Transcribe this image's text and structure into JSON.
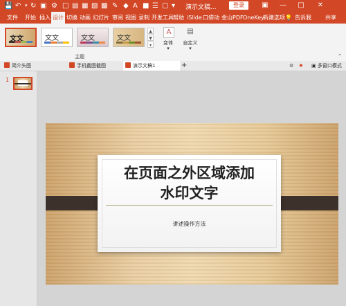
{
  "titlebar": {
    "doc_title": "演示文稿...",
    "login": "登录",
    "qa_icons": [
      "save-icon",
      "undo-icon",
      "redo-icon",
      "start-icon"
    ]
  },
  "menu": {
    "items": [
      "文件",
      "开始",
      "插入",
      "设计",
      "切换",
      "动画",
      "幻灯片",
      "审阅",
      "视图",
      "录制",
      "开发工具",
      "帮助",
      "iSlide",
      "口袋动",
      "金山PDF",
      "OneKey",
      "新建选项",
      "告诉我",
      "共享"
    ],
    "active_index": 3
  },
  "ribbon": {
    "theme_labels": [
      "文文",
      "文文",
      "文文",
      "文文"
    ],
    "themes_group_label": "主题",
    "variants_label": "变体",
    "customize_label": "自定义"
  },
  "tabs": {
    "items": [
      "简介头图",
      "手机截图截图",
      "演示文稿1"
    ],
    "active_index": 2,
    "multi_window": "多窗口模式"
  },
  "thumbnails": {
    "slide_number": "1"
  },
  "slide": {
    "title_line1": "在页面之外区域添加",
    "title_line2": "水印文字",
    "subtitle": "讲述操作方法"
  },
  "colors": {
    "accent": "#d24726"
  }
}
